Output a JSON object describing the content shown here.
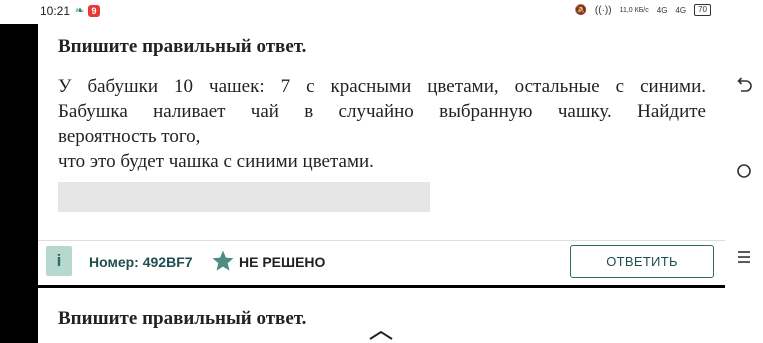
{
  "statusbar": {
    "time": "10:21",
    "app_badge": "9",
    "network_speed": "11,0 КБ/с",
    "signal_1": "4G",
    "signal_2": "4G",
    "battery": "70"
  },
  "task": {
    "title": "Впишите правильный ответ.",
    "line1": "У бабушки 10 чашек: 7 с красными цветами, остальные с синими.",
    "line2": "Бабушка наливает чай в случайно выбранную чашку. Найдите",
    "line3": "вероятность того,",
    "line4": "что это будет чашка с синими цветами.",
    "answer_value": ""
  },
  "info_bar": {
    "badge": "i",
    "number": "Номер: 492BF7",
    "status": "НЕ РЕШЕНО",
    "answer_button": "ОТВЕТИТЬ"
  },
  "next_task": {
    "title": "Впишите правильный ответ."
  },
  "colors": {
    "accent": "#2a6b62",
    "badge_bg": "#b7d8cf",
    "star": "#4f8c86",
    "field_bg": "#e6e6e6"
  }
}
